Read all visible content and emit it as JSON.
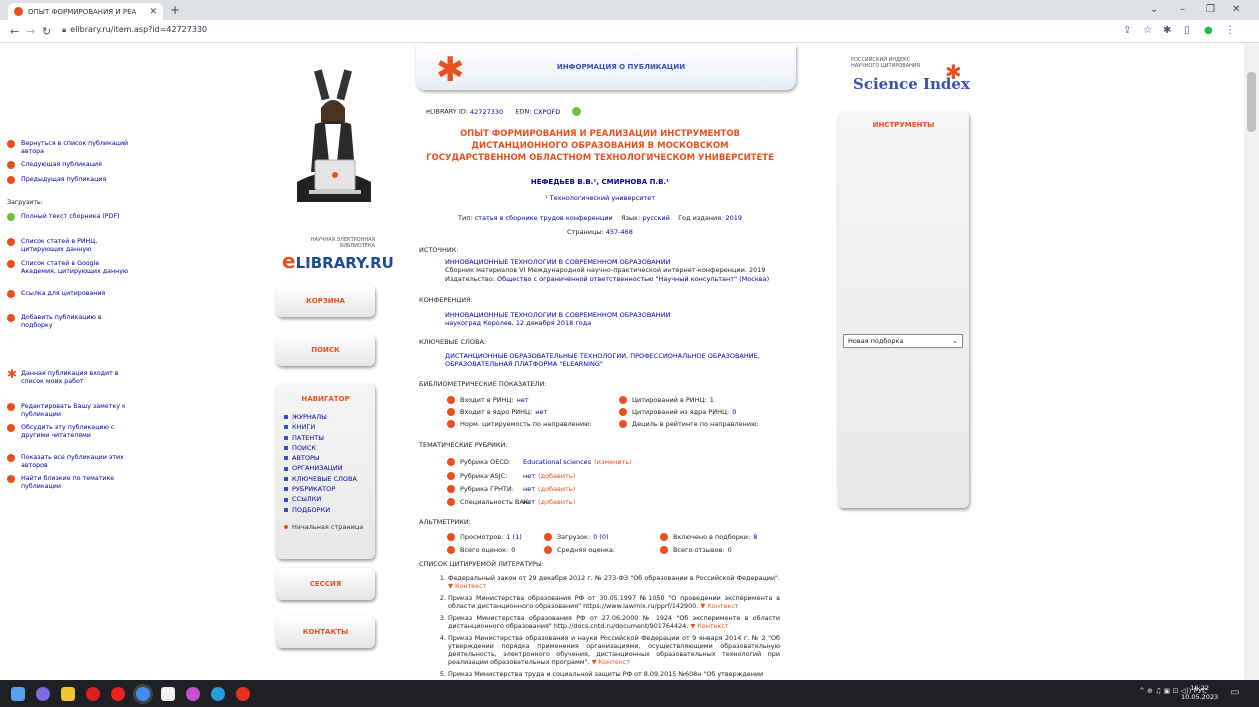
{
  "browser": {
    "tab_title": "ОПЫТ ФОРМИРОВАНИЯ И РЕА",
    "url": "elibrary.ru/item.asp?id=42727330"
  },
  "left": {
    "logo_small_1": "НАУЧНАЯ ЭЛЕКТРОННАЯ",
    "logo_small_2": "БИБЛИОТЕКА",
    "logo_e": "e",
    "logo_text": "LIBRARY.RU",
    "cart": "КОРЗИНА",
    "search": "ПОИСК",
    "navigator": "НАВИГАТОР",
    "nav_items": [
      "ЖУРНАЛЫ",
      "КНИГИ",
      "ПАТЕНТЫ",
      "ПОИСК",
      "АВТОРЫ",
      "ОРГАНИЗАЦИИ",
      "КЛЮЧЕВЫЕ СЛОВА",
      "РУБРИКАТОР",
      "ССЫЛКИ",
      "ПОДБОРКИ"
    ],
    "home": "Начальная страница",
    "session": "СЕССИЯ",
    "contacts": "КОНТАКТЫ"
  },
  "banner": {
    "title": "ИНФОРМАЦИЯ О ПУБЛИКАЦИИ"
  },
  "pub": {
    "elib_id_label": "eLIBRARY ID:",
    "elib_id": "42727330",
    "edn_label": "EDN:",
    "edn": "CXPOFD",
    "title": "ОПЫТ ФОРМИРОВАНИЯ И РЕАЛИЗАЦИИ ИНСТРУМЕНТОВ ДИСТАНЦИОННОГО ОБРАЗОВАНИЯ В МОСКОВСКОМ ГОСУДАРСТВЕННОМ ОБЛАСТНОМ ТЕХНОЛОГИЧЕСКОМ УНИВЕРСИТЕТЕ",
    "authors": "НЕФЕДЬЕВ В.В.¹, СМИРНОВА П.В.¹",
    "org": "¹ Технологический университет",
    "type_label": "Тип:",
    "type": "статья в сборнике трудов конференции",
    "lang_label": "Язык:",
    "lang": "русский",
    "year_label": "Год издания:",
    "year": "2019",
    "pages_label": "Страницы:",
    "pages": "457-468"
  },
  "source": {
    "label": "ИСТОЧНИК:",
    "line1": "ИННОВАЦИОННЫЕ ТЕХНОЛОГИИ В СОВРЕМЕННОМ ОБРАЗОВАНИИ",
    "line2": "Сборник материалов VI Международной научно-практической интернет-конференции. 2019",
    "line3_label": "Издательство:",
    "line3": "Общество с ограниченной ответственностью \"Научный консультант\" (Москва)"
  },
  "conference": {
    "label": "КОНФЕРЕНЦИЯ:",
    "line1": "ИННОВАЦИОННЫЕ ТЕХНОЛОГИИ В СОВРЕМЕННОМ ОБРАЗОВАНИИ",
    "line2": "наукоград Королев, 12 декабря 2018 года"
  },
  "keywords": {
    "label": "КЛЮЧЕВЫЕ СЛОВА:",
    "line1": "ДИСТАНЦИОННЫЕ ОБРАЗОВАТЕЛЬНЫЕ ТЕХНОЛОГИИ, ПРОФЕССИОНАЛЬНОЕ ОБРАЗОВАНИЕ,",
    "line2": "ОБРАЗОВАТЕЛЬНАЯ ПЛАТФОРМА \"ELEARNING\""
  },
  "biblio": {
    "label": "БИБЛИОМЕТРИЧЕСКИЕ ПОКАЗАТЕЛИ:",
    "rinc": "Входит в РИНЦ:",
    "rinc_v": "нет",
    "core": "Входит в ядро РИНЦ:",
    "core_v": "нет",
    "norm": "Норм. цитируемость по направлению:",
    "cited": "Цитирований в РИНЦ:",
    "cited_v": "1",
    "cited_core": "Цитирований из ядра РИНЦ:",
    "cited_core_v": "0",
    "decile": "Дециль в рейтинге по направлению:"
  },
  "rubrics": {
    "label": "ТЕМАТИЧЕСКИЕ РУБРИКИ:",
    "oecd": "Рубрика OECD:",
    "oecd_v": "Educational sciences",
    "oecd_edit": "(изменить)",
    "asjc": "Рубрика ASJC:",
    "asjc_v": "нет",
    "add1": "(добавить)",
    "grnti": "Рубрика ГРНТИ:",
    "grnti_v": "нет",
    "add2": "(добавить)",
    "vak": "Специальность ВАК:",
    "vak_v": "нет",
    "add3": "(добавить)"
  },
  "altmetrics": {
    "label": "АЛЬТМЕТРИКИ:",
    "views": "Просмотров:",
    "views_v": "1 (1)",
    "downloads": "Загрузок:",
    "downloads_v": "0 (0)",
    "collections": "Включено в подборки:",
    "collections_v": "8",
    "ratings": "Всего оценок:",
    "ratings_v": "0",
    "avg": "Средняя оценка:",
    "reviews": "Всего отзывов:",
    "reviews_v": "0"
  },
  "references": {
    "label": "СПИСОК ЦИТИРУЕМОЙ ЛИТЕРАТУРЫ:",
    "ctx": "▼ Контекст",
    "items": [
      "Федеральный закон от 29 декабря 2012 г. № 273-ФЗ \"Об образовании в Российской Федерации\".",
      "Приказ Министерства образования РФ от 30.05.1997 №1050 \"О проведении эксперимента в области дистанционного образования\" https://www.lawmix.ru/pprf/142900.",
      "Приказ Министерства образования РФ от 27.06.2000 № 1924 \"Об эксперименте в области дистанционного образования\" http://docs.cntd.ru/document/901764424.",
      "Приказ Министерства образования и науки Российской Федерации от 9 января 2014 г. № 2 \"Об утверждении порядка применения организациями, осуществляющими образовательную деятельность, электронного обучения, дистанционных образовательных технологий при реализации образовательных программ\".",
      "Приказ Министерства труда и социальной защиты РФ от 8.09.2015 №608н \"Об утверждении"
    ]
  },
  "right": {
    "si_small_1": "РОССИЙСКИЙ ИНДЕКС",
    "si_small_2": "НАУЧНОГО ЦИТИРОВАНИЯ",
    "si_big": "Science Index",
    "tools": "ИНСТРУМЕНТЫ",
    "t1": "Вернуться в список публикаций автора",
    "t2": "Следующая публикация",
    "t3": "Предыдущая публикация",
    "download_label": "Загрузить:",
    "t4": "Полный текст сборника (PDF)",
    "t5": "Список статей в РИНЦ, цитирующих данную",
    "t6": "Список статей в Google Академия, цитирующих данную",
    "t7": "Ссылка для цитирования",
    "t8": "Добавить публикацию в подборку",
    "select": "Новая подборка",
    "t9": "Данная публикация входит в список моих работ",
    "t10": "Редактировать Вашу заметку к публикации",
    "t11": "Обсудить эту публикацию с другими читателями",
    "t12": "Показать все публикации этих авторов",
    "t13": "Найти близкие по тематике публикации"
  },
  "taskbar": {
    "lang": "РУС",
    "time": "16:22",
    "date": "10.05.2023"
  }
}
